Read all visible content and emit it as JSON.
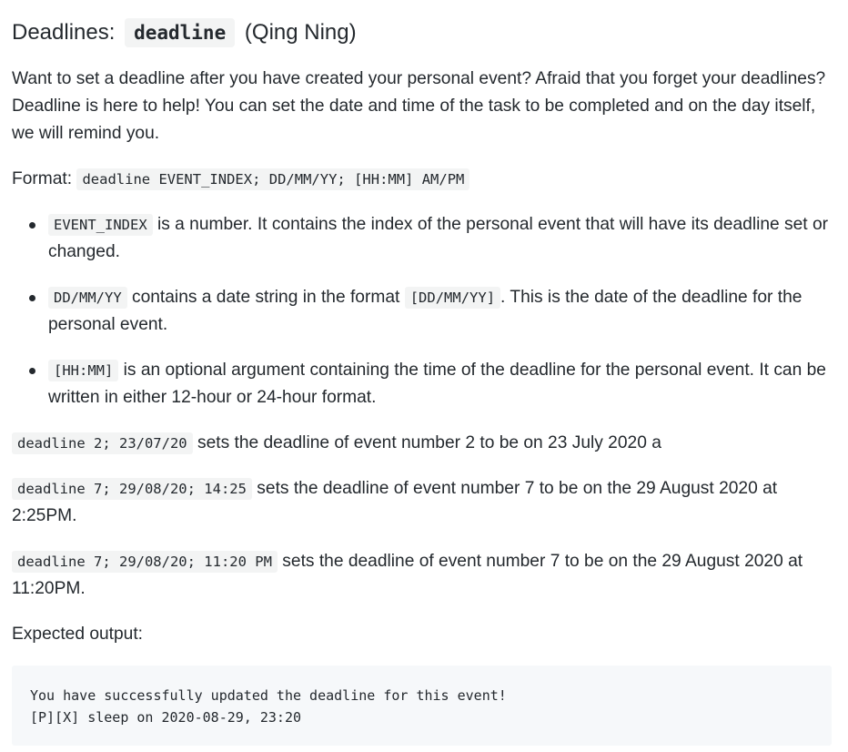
{
  "heading": {
    "prefix": "Deadlines:",
    "code": "deadline",
    "suffix": "(Qing Ning)"
  },
  "intro": "Want to set a deadline after you have created your personal event? Afraid that you forget your deadlines? Deadline is here to help! You can set the date and time of the task to be completed and on the day itself, we will remind you.",
  "format": {
    "label": "Format:",
    "code": "deadline EVENT_INDEX; DD/MM/YY; [HH:MM] AM/PM"
  },
  "bullets": [
    {
      "code": "EVENT_INDEX",
      "text_before": "",
      "text_after": " is a number. It contains the index of the personal event that will have its deadline set or changed."
    },
    {
      "code": "DD/MM/YY",
      "text_mid": " contains a date string in the format ",
      "code2": "[DD/MM/YY]",
      "text_after": ". This is the date of the deadline for the personal event."
    },
    {
      "code": "[HH:MM]",
      "text_after": " is an optional argument containing the time of the deadline for the personal event. It can be written in either 12-hour or 24-hour format."
    }
  ],
  "examples": [
    {
      "code": "deadline 2; 23/07/20",
      "text": " sets the deadline of event number 2 to be on 23 July 2020 a"
    },
    {
      "code": "deadline 7; 29/08/20; 14:25",
      "text": " sets the deadline of event number 7 to be on the 29 August 2020 at 2:25PM."
    },
    {
      "code": "deadline 7; 29/08/20; 11:20 PM",
      "text": " sets the deadline of event number 7 to be on the 29 August 2020 at 11:20PM."
    }
  ],
  "expected_label": "Expected output:",
  "output_lines": [
    "You have successfully updated the deadline for this event!",
    "[P][X] sleep on 2020-08-29, 23:20"
  ]
}
